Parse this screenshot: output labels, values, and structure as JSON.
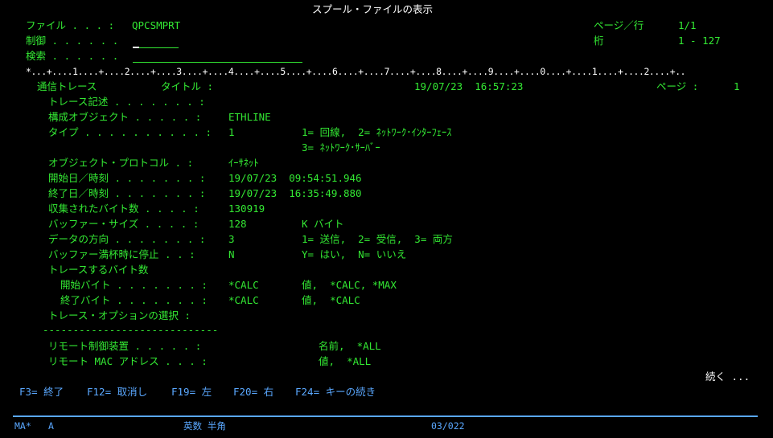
{
  "title": "スプール・ファイルの表示",
  "header": {
    "file_label": "ファイル . . . :",
    "file_value": "QPCSMPRT",
    "control_label": "制御 . . . . . .",
    "search_label": "検索 . . . . . .",
    "page_label": "ページ／行",
    "page_value": "1/1",
    "column_label": "桁",
    "column_value": "1 - 127"
  },
  "ruler": "*...+....1....+....2....+....3....+....4....+....5....+....6....+....7....+....8....+....9....+....0....+....1....+....2....+..",
  "report": {
    "heading_left": "通信トレース",
    "heading_title": "タイトル :",
    "heading_date": "19/07/23  16:57:23",
    "heading_page_label": "ページ :",
    "heading_page_value": "1",
    "rows": [
      {
        "label": "トレース記述 . . . . . . . :",
        "value": "",
        "note": ""
      },
      {
        "label": "構成オブジェクト . . . . . :",
        "value": "ETHLINE",
        "note": ""
      },
      {
        "label": "タイプ . . . . . . . . . . :",
        "value": "1",
        "note": "1= 回線,  2= ﾈｯﾄﾜｰｸ･ｲﾝﾀｰﾌｪｰｽ"
      },
      {
        "label": "",
        "value": "",
        "note": "3= ﾈｯﾄﾜｰｸ･ｻｰﾊﾞｰ"
      },
      {
        "label": "オブジェクト・プロトコル . :",
        "value": "ｲｰｻﾈｯﾄ",
        "note": ""
      },
      {
        "label": "開始日／時刻 . . . . . . . :",
        "value": "19/07/23  09:54:51.946",
        "note": ""
      },
      {
        "label": "終了日／時刻 . . . . . . . :",
        "value": "19/07/23  16:35:49.880",
        "note": ""
      },
      {
        "label": "収集されたバイト数 . . . . :",
        "value": "130919",
        "note": ""
      },
      {
        "label": "バッファー・サイズ . . . . :",
        "value": "128",
        "note": "K バイト"
      },
      {
        "label": "データの方向 . . . . . . . :",
        "value": "3",
        "note": "1= 送信,  2= 受信,  3= 両方"
      },
      {
        "label": "バッファー満杯時に停止 . . :",
        "value": "N",
        "note": "Y= はい,  N= いいえ"
      },
      {
        "label": "トレースするバイト数",
        "value": "",
        "note": ""
      },
      {
        "label": "  開始バイト . . . . . . . :",
        "value": "*CALC",
        "note": "値,  *CALC, *MAX"
      },
      {
        "label": "  終了バイト . . . . . . . :",
        "value": "*CALC",
        "note": "値,  *CALC"
      },
      {
        "label": "トレース・オプションの選択 :",
        "value": "",
        "note": ""
      }
    ],
    "dashes": "-----------------------------",
    "remote_rows": [
      {
        "label": "リモート制御装置 . . . . . :",
        "note": "名前,  *ALL"
      },
      {
        "label": "リモート MAC アドレス . . . :",
        "note": "値,  *ALL"
      }
    ]
  },
  "more": "続く ...",
  "function_keys": [
    {
      "key": "F3=",
      "label": "終了"
    },
    {
      "key": "F12=",
      "label": "取消し"
    },
    {
      "key": "F19=",
      "label": "左"
    },
    {
      "key": "F20=",
      "label": "右"
    },
    {
      "key": "F24=",
      "label": "キーの続き"
    }
  ],
  "status": {
    "session": "MA*",
    "mode": "A",
    "input_mode": "英数 半角",
    "cursor_pos": "03/022"
  },
  "colors": {
    "background": "#000000",
    "text": "#33e833",
    "title": "#ffffff",
    "function_keys": "#5aa8ff"
  }
}
